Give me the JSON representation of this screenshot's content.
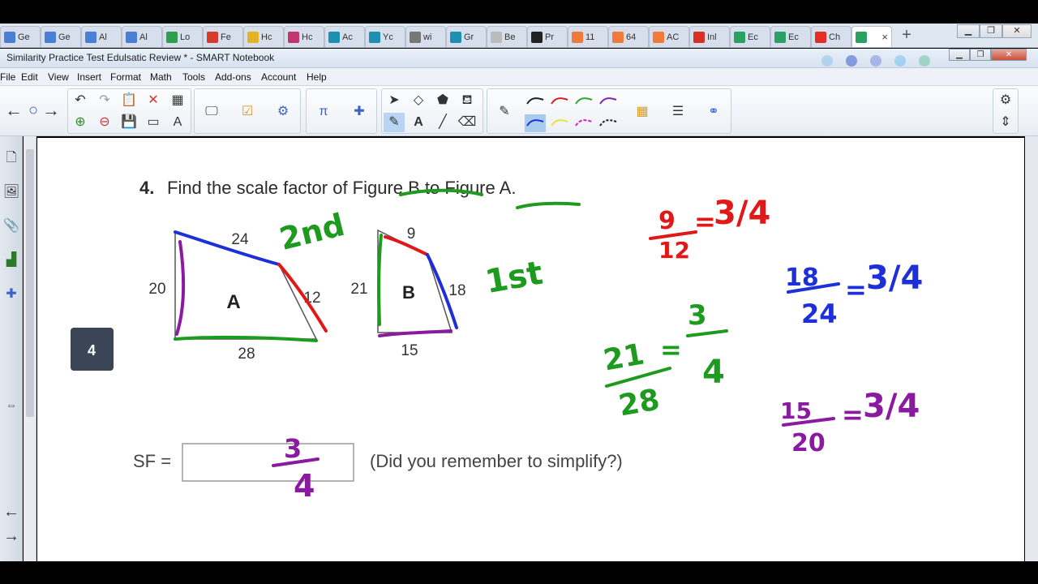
{
  "browser": {
    "tabs": [
      {
        "label": "Ge",
        "icon": "google-docs-icon",
        "color": "#4a7fd6"
      },
      {
        "label": "Ge",
        "icon": "google-docs-icon",
        "color": "#4a7fd6"
      },
      {
        "label": "Al",
        "icon": "google-docs-icon",
        "color": "#4a7fd6"
      },
      {
        "label": "Al",
        "icon": "google-docs-icon",
        "color": "#4a7fd6"
      },
      {
        "label": "Lo",
        "icon": "google-drive-icon",
        "color": "#2f9e4f"
      },
      {
        "label": "Fe",
        "icon": "tab-i-icon",
        "color": "#d83b2b"
      },
      {
        "label": "Hc",
        "icon": "tab-h-icon",
        "color": "#e2b322"
      },
      {
        "label": "Hc",
        "icon": "heart-icon",
        "color": "#c2366b"
      },
      {
        "label": "Ac",
        "icon": "tab-b-icon",
        "color": "#1d8fb0"
      },
      {
        "label": "Yc",
        "icon": "tab-b-icon",
        "color": "#1d8fb0"
      },
      {
        "label": "wi",
        "icon": "globe-icon",
        "color": "#777777"
      },
      {
        "label": "Gr",
        "icon": "tab-b-icon",
        "color": "#1d8fb0"
      },
      {
        "label": "Be",
        "icon": "page-icon",
        "color": "#bbbbbb"
      },
      {
        "label": "Pr",
        "icon": "graduation-cap-icon",
        "color": "#222222"
      },
      {
        "label": "11",
        "icon": "hubspot-icon",
        "color": "#ef7a3a"
      },
      {
        "label": "64",
        "icon": "hubspot-icon",
        "color": "#ef7a3a"
      },
      {
        "label": "AC",
        "icon": "hubspot-icon",
        "color": "#ef7a3a"
      },
      {
        "label": "Inl",
        "icon": "gmail-icon",
        "color": "#d93025"
      },
      {
        "label": "Ec",
        "icon": "edulastic-icon",
        "color": "#2aa162"
      },
      {
        "label": "Ec",
        "icon": "edulastic-icon",
        "color": "#2aa162"
      },
      {
        "label": "Ch",
        "icon": "youtube-icon",
        "color": "#e52d27"
      },
      {
        "label": "",
        "icon": "edulastic-icon",
        "color": "#2aa162"
      }
    ],
    "new_tab": "+",
    "close_tab": "×"
  },
  "window": {
    "title": "Similarity Practice Test Edulsatic Review * - SMART Notebook"
  },
  "menu": [
    "File",
    "Edit",
    "View",
    "Insert",
    "Format",
    "Math",
    "Tools",
    "Add-ons",
    "Account",
    "Help"
  ],
  "question": {
    "number": "4.",
    "text": "Find the scale factor of Figure B to Figure A.",
    "badge": "4",
    "sf_label": "SF =",
    "hint": "(Did you remember to simplify?)"
  },
  "figure_a": {
    "label": "A",
    "top": "24",
    "left": "20",
    "right": "12",
    "bottom": "28"
  },
  "figure_b": {
    "label": "B",
    "top": "9",
    "left": "21",
    "right": "18",
    "bottom": "15"
  },
  "handwriting": {
    "second": "2nd",
    "first": "1st",
    "answer_num": "3",
    "answer_den": "4",
    "red_eq": {
      "num": "9",
      "den": "12",
      "result": "3/4"
    },
    "blue_eq": {
      "num": "18",
      "den": "24",
      "result": "3/4"
    },
    "green_eq": {
      "num": "21",
      "den": "28",
      "rnum": "3",
      "rden": "4"
    },
    "purple_eq": {
      "num": "15",
      "den": "20",
      "result": "3/4"
    },
    "equals": "="
  },
  "colors": {
    "red": "#e01818",
    "blue": "#1d2fd8",
    "green": "#1e9a1e",
    "purple": "#8a1aa0"
  }
}
